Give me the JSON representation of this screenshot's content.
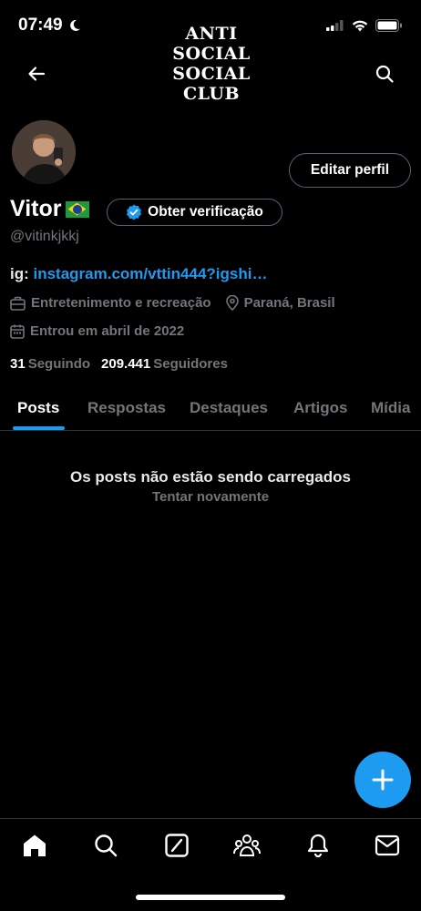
{
  "status_bar": {
    "time": "07:49"
  },
  "banner": {
    "logo_lines": [
      "ANTI",
      "SOCIAL",
      "SOCIAL",
      "CLUB"
    ]
  },
  "profile": {
    "edit_label": "Editar perfil",
    "name": "Vitor",
    "verify_label": "Obter verificação",
    "handle": "@vitinkjkkj",
    "bio_prefix": "ig: ",
    "bio_link": "instagram.com/vttin444?igshi…",
    "category": "Entretenimento e recreação",
    "location": "Paraná, Brasil",
    "joined": "Entrou em abril de 2022",
    "following_count": "31",
    "following_label": "Seguindo",
    "followers_count": "209.441",
    "followers_label": "Seguidores"
  },
  "tabs": [
    {
      "label": "Posts"
    },
    {
      "label": "Respostas"
    },
    {
      "label": "Destaques"
    },
    {
      "label": "Artigos"
    },
    {
      "label": "Mídia"
    }
  ],
  "empty_state": {
    "title": "Os posts não estão sendo carregados",
    "retry": "Tentar novamente"
  },
  "bottom_nav": [
    "home-icon",
    "search-icon",
    "grok-icon",
    "communities-icon",
    "notifications-icon",
    "messages-icon"
  ],
  "colors": {
    "accent": "#1d9bf0",
    "background": "#000000",
    "muted": "#71767b"
  }
}
